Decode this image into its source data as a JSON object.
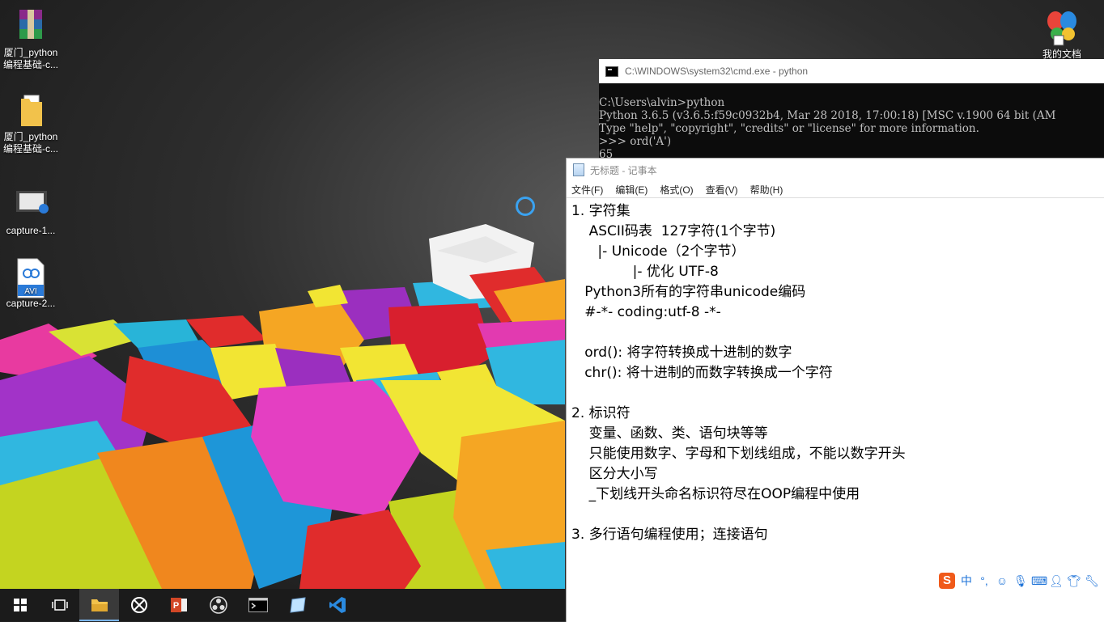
{
  "desktop": {
    "icons": [
      {
        "name": "winrar-archive",
        "label": "厦门_python\n编程基础-c...",
        "type": "rar"
      },
      {
        "name": "folder",
        "label": "厦门_python\n编程基础-c...",
        "type": "folder"
      },
      {
        "name": "video-capture-1",
        "label": "capture-1...",
        "type": "video"
      },
      {
        "name": "avi-capture-2",
        "label": "capture-2...",
        "type": "avi",
        "badge": "AVI"
      }
    ],
    "my_documents": {
      "label": "我的文档"
    }
  },
  "cmd": {
    "title": "C:\\WINDOWS\\system32\\cmd.exe - python",
    "lines": [
      "C:\\Users\\alvin>python",
      "Python 3.6.5 (v3.6.5:f59c0932b4, Mar 28 2018, 17:00:18) [MSC v.1900 64 bit (AM",
      "Type \"help\", \"copyright\", \"credits\" or \"license\" for more information.",
      ">>> ord('A')",
      "65"
    ]
  },
  "notepad": {
    "title": "无标题 - 记事本",
    "menu": [
      "文件(F)",
      "编辑(E)",
      "格式(O)",
      "查看(V)",
      "帮助(H)"
    ],
    "lines": [
      "1. 字符集",
      "    ASCII码表  127字符(1个字节)",
      "      |- Unicode（2个字节）",
      "              |- 优化 UTF-8",
      "   Python3所有的字符串unicode编码",
      "   #-*- coding:utf-8 -*-",
      "",
      "   ord(): 将字符转换成十进制的数字",
      "   chr(): 将十进制的而数字转换成一个字符",
      "",
      "2. 标识符",
      "    变量、函数、类、语句块等等",
      "    只能使用数字、字母和下划线组成，不能以数字开头",
      "    区分大小写",
      "    _下划线开头命名标识符尽在OOP编程中使用",
      "",
      "3. 多行语句编程使用；连接语句"
    ]
  },
  "ime": {
    "logo": "S",
    "mode": "中",
    "punct": "°,",
    "icons": [
      "smile-icon",
      "mic-icon",
      "keyboard-icon",
      "user-icon",
      "shirt-icon",
      "wrench-icon"
    ]
  },
  "taskbar": {
    "items": [
      {
        "name": "start",
        "icon": "windows-logo-icon"
      },
      {
        "name": "task-view",
        "icon": "task-view-icon"
      },
      {
        "name": "file-explorer",
        "icon": "folder-icon",
        "active": true
      },
      {
        "name": "xbox",
        "icon": "xbox-icon"
      },
      {
        "name": "powerpoint",
        "icon": "powerpoint-icon"
      },
      {
        "name": "obs",
        "icon": "obs-icon"
      },
      {
        "name": "cmd",
        "icon": "terminal-icon"
      },
      {
        "name": "notepad",
        "icon": "notepad-icon"
      },
      {
        "name": "vscode",
        "icon": "vscode-icon"
      }
    ]
  },
  "colors": {
    "accent": "#7ab4ea",
    "cmd_bg": "#0c0c0c",
    "ime": "#f05a1a"
  }
}
